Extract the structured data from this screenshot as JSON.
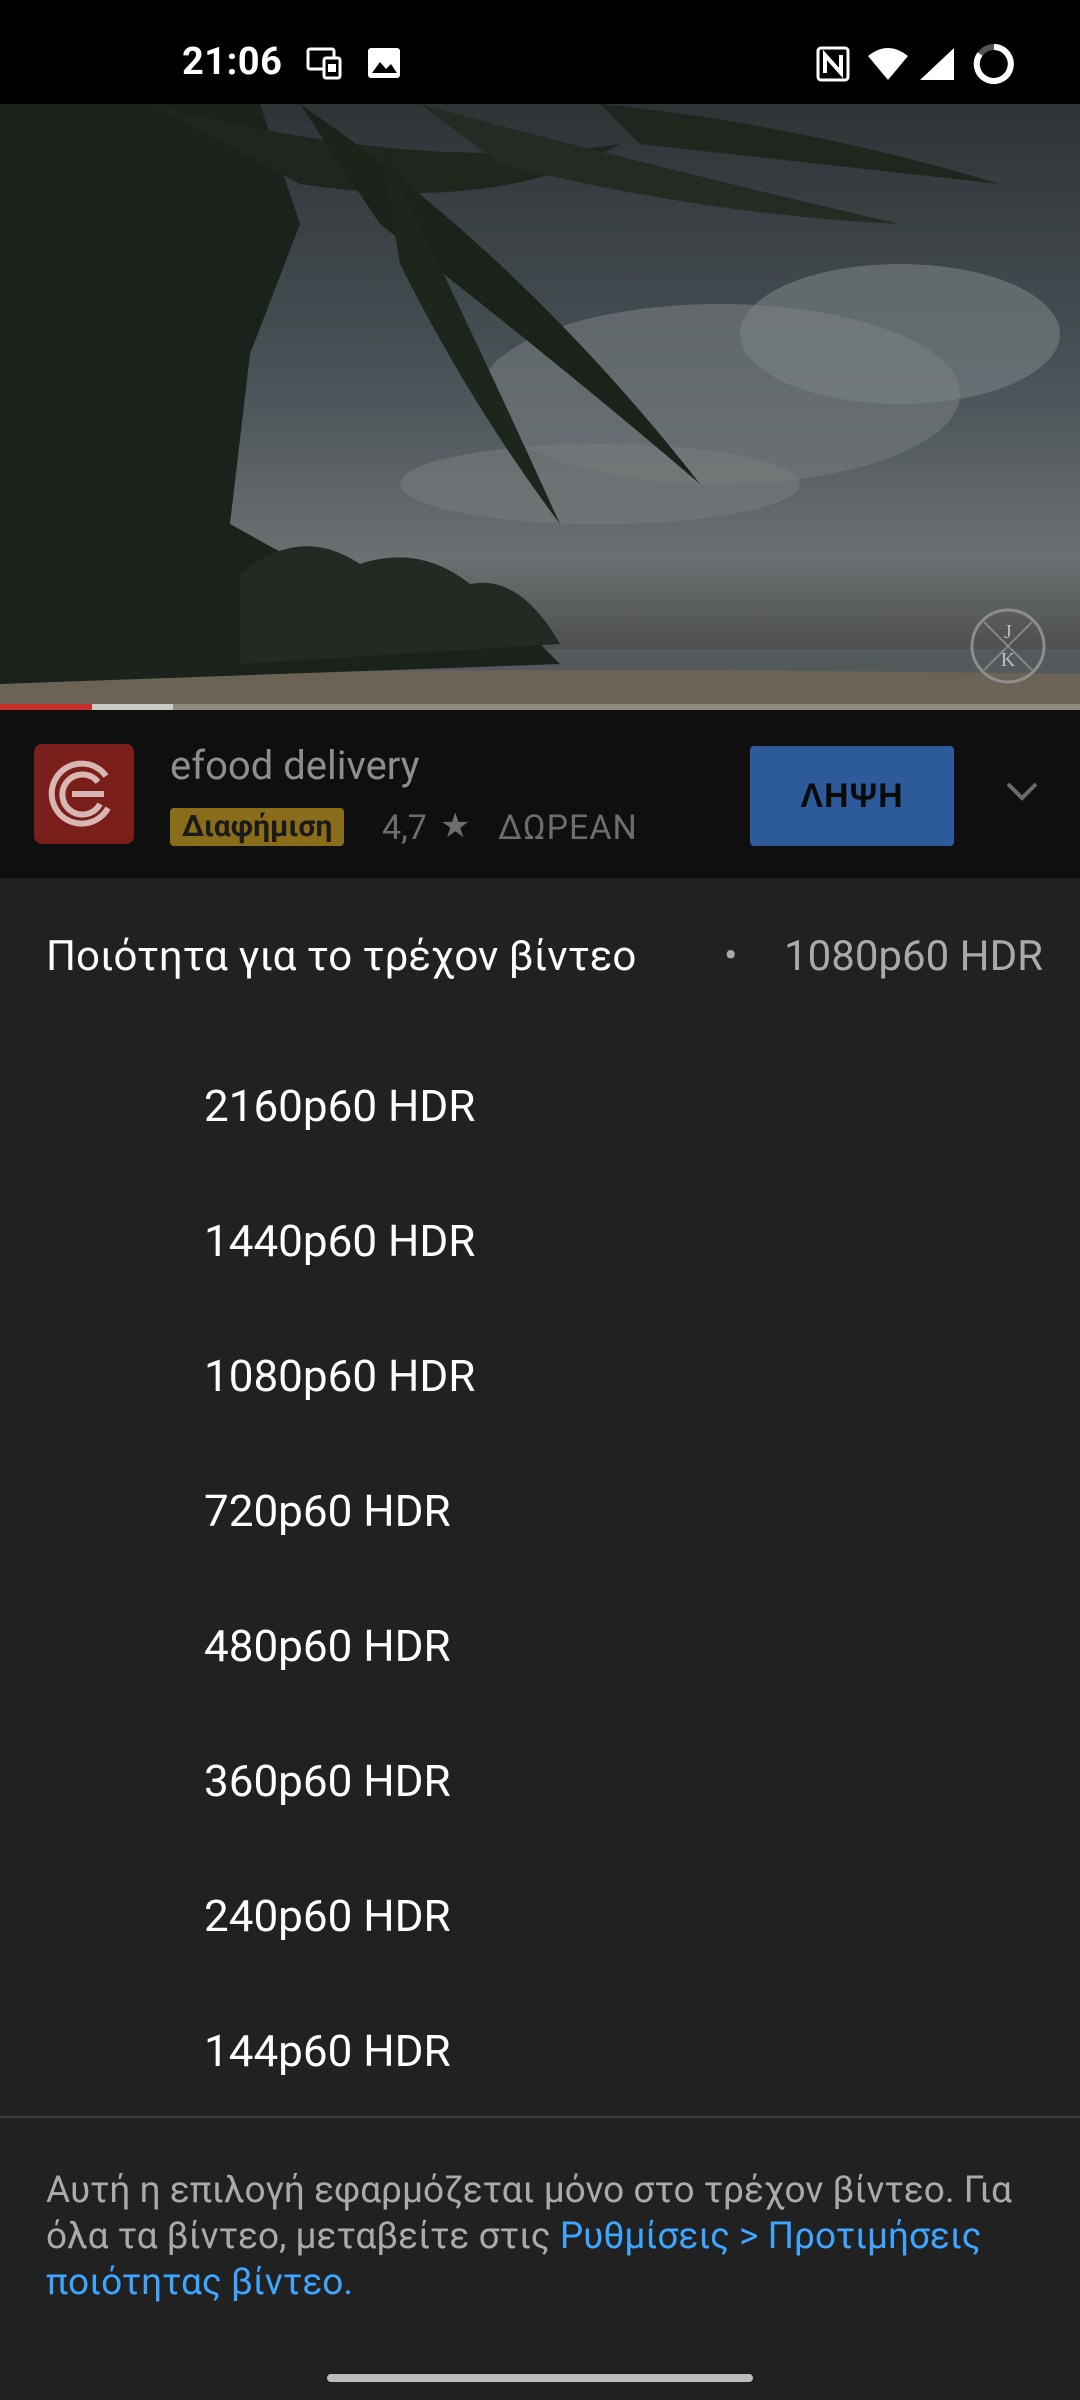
{
  "status_bar": {
    "time": "21:06",
    "left_icons": [
      "screen-cast-icon",
      "image-icon"
    ],
    "right_icons": [
      "nfc-icon",
      "wifi-icon",
      "cell-signal-icon",
      "battery-ring-icon"
    ]
  },
  "player": {
    "watermark_letters": "J K",
    "progress_played": 0.085,
    "progress_buffered": 0.16
  },
  "ad": {
    "title": "efood delivery",
    "badge": "Διαφήμιση",
    "rating": "4,7",
    "price": "ΔΩΡΕΑΝ",
    "cta_label": "ΛΗΨΗ",
    "colors": {
      "logo_bg": "#7a1e1a",
      "cta_bg": "#2d5a9a",
      "badge_bg": "#8a6d1a"
    }
  },
  "quality_sheet": {
    "title": "Ποιότητα για το τρέχον βίντεο",
    "separator": "•",
    "current": "1080p60 HDR",
    "options": [
      "2160p60 HDR",
      "1440p60 HDR",
      "1080p60 HDR",
      "720p60 HDR",
      "480p60 HDR",
      "360p60 HDR",
      "240p60 HDR",
      "144p60 HDR"
    ],
    "footnote_text": "Αυτή η επιλογή εφαρμόζεται μόνο στο τρέχον βίντεο. Για όλα τα βίντεο, μεταβείτε στις ",
    "footnote_link": "Ρυθμίσεις > Προτιμήσεις ποιότητας βίντεο."
  }
}
